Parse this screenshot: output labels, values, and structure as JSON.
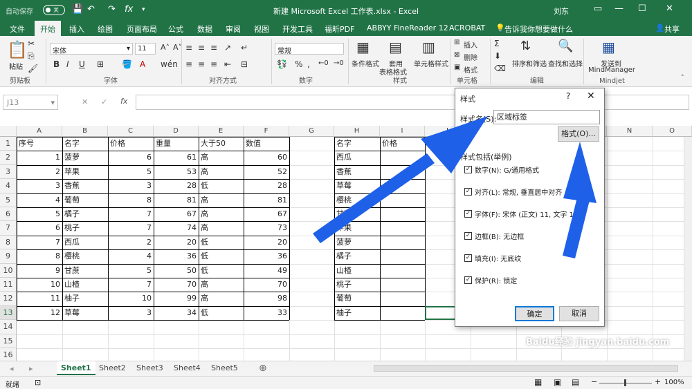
{
  "titlebar": {
    "autosave_label": "自动保存",
    "autosave_state": "关",
    "doc_title": "新建 Microsoft Excel 工作表.xlsx - Excel",
    "user": "刘东"
  },
  "ribbon_tabs": [
    "文件",
    "开始",
    "插入",
    "绘图",
    "页面布局",
    "公式",
    "数据",
    "审阅",
    "视图",
    "开发工具",
    "福昕PDF",
    "ABBYY FineReader 12",
    "ACROBAT",
    "告诉我你想要做什么"
  ],
  "share_label": "共享",
  "ribbon": {
    "paste": "粘贴",
    "font_name": "宋体",
    "font_size": "11",
    "number_format": "常规",
    "conditional": "条件格式",
    "table_format_1": "套用",
    "table_format_2": "表格格式",
    "cell_style": "单元格样式",
    "insert": "插入",
    "delete": "删除",
    "format": "格式",
    "sort": "排序和筛选",
    "find": "查找和选择",
    "mindjet_1": "发送到",
    "mindjet_2": "MindManager",
    "groups": {
      "clipboard": "剪贴板",
      "font": "字体",
      "align": "对齐方式",
      "number": "数字",
      "styles": "样式",
      "cells": "单元格",
      "editing": "编辑",
      "mindjet": "Mindjet"
    }
  },
  "formula": {
    "name_box": "J13",
    "fx": "fx",
    "cancel": "✕",
    "enter": "✓"
  },
  "grid": {
    "columns": [
      "A",
      "B",
      "C",
      "D",
      "E",
      "F",
      "G",
      "H",
      "I",
      "J",
      "K",
      "L",
      "M",
      "N",
      "O"
    ],
    "rows": [
      "1",
      "2",
      "3",
      "4",
      "5",
      "6",
      "7",
      "8",
      "9",
      "10",
      "11",
      "12",
      "13",
      "14",
      "15",
      "16"
    ],
    "headers1": [
      "序号",
      "名字",
      "价格",
      "重量",
      "大于50",
      "数值"
    ],
    "table1": [
      [
        "1",
        "菠萝",
        "6",
        "61",
        "高",
        "60"
      ],
      [
        "2",
        "苹果",
        "5",
        "53",
        "高",
        "52"
      ],
      [
        "3",
        "香蕉",
        "3",
        "28",
        "低",
        "28"
      ],
      [
        "4",
        "葡萄",
        "8",
        "81",
        "高",
        "81"
      ],
      [
        "5",
        "橘子",
        "7",
        "67",
        "高",
        "67"
      ],
      [
        "6",
        "桃子",
        "7",
        "74",
        "高",
        "73"
      ],
      [
        "7",
        "西瓜",
        "2",
        "20",
        "低",
        "20"
      ],
      [
        "8",
        "樱桃",
        "4",
        "36",
        "低",
        "36"
      ],
      [
        "9",
        "甘蔗",
        "5",
        "50",
        "低",
        "49"
      ],
      [
        "10",
        "山楂",
        "7",
        "70",
        "高",
        "70"
      ],
      [
        "11",
        "柚子",
        "10",
        "99",
        "高",
        "98"
      ],
      [
        "12",
        "草莓",
        "3",
        "34",
        "低",
        "33"
      ]
    ],
    "headers2": [
      "名字",
      "价格"
    ],
    "table2": [
      "西瓜",
      "香蕉",
      "草莓",
      "樱桃",
      "甘蔗",
      "苹果",
      "菠萝",
      "橘子",
      "山楂",
      "桃子",
      "葡萄",
      "柚子"
    ]
  },
  "sheets": [
    "Sheet1",
    "Sheet2",
    "Sheet3",
    "Sheet4",
    "Sheet5"
  ],
  "status": {
    "ready": "就绪",
    "zoom": "100%"
  },
  "dialog": {
    "title": "样式",
    "help": "?",
    "close": "✕",
    "name_label": "样式名(S):",
    "name_value": "区域标签",
    "format_button": "格式(O)...",
    "section": "样式包括(举例)",
    "options": [
      "数字(N): G/通用格式",
      "对齐(L): 常规, 垂直居中对齐",
      "字体(F): 宋体 (正文) 11, 文字 1",
      "边框(B): 无边框",
      "填充(I): 无底纹",
      "保护(R): 锁定"
    ],
    "ok": "确定",
    "cancel": "取消"
  },
  "watermark": "Baidu经验 jingyan.baidu.com",
  "colors": {
    "accent": "#217346",
    "arrow": "#1e60e8"
  }
}
